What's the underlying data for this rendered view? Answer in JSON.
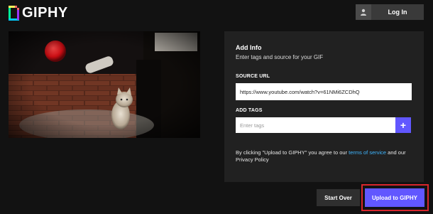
{
  "header": {
    "logo_text": "GIPHY",
    "login_label": "Log In"
  },
  "video": {
    "thumbnail": "kitten-on-bubble-wrap"
  },
  "panel": {
    "title": "Add Info",
    "subtitle": "Enter tags and source for your GIF",
    "source_label": "SOURCE URL",
    "source_value": "https://www.youtube.com/watch?v=61NMi6ZCDhQ",
    "tags_label": "ADD TAGS",
    "tags_placeholder": "Enter tags",
    "add_tag_symbol": "+",
    "terms_before": "By clicking \"Upload to GIPHY\" you agree to our ",
    "terms_link": "terms of service",
    "terms_after": " and our Privacy Policy"
  },
  "actions": {
    "start_over": "Start Over",
    "upload": "Upload to GIPHY"
  },
  "colors": {
    "background": "#121212",
    "panel": "#212121",
    "accent": "#6157ff",
    "link": "#3fb6ff",
    "highlight": "#d8262c"
  },
  "icons": {
    "login": "user-icon",
    "add_tag": "plus-icon"
  }
}
